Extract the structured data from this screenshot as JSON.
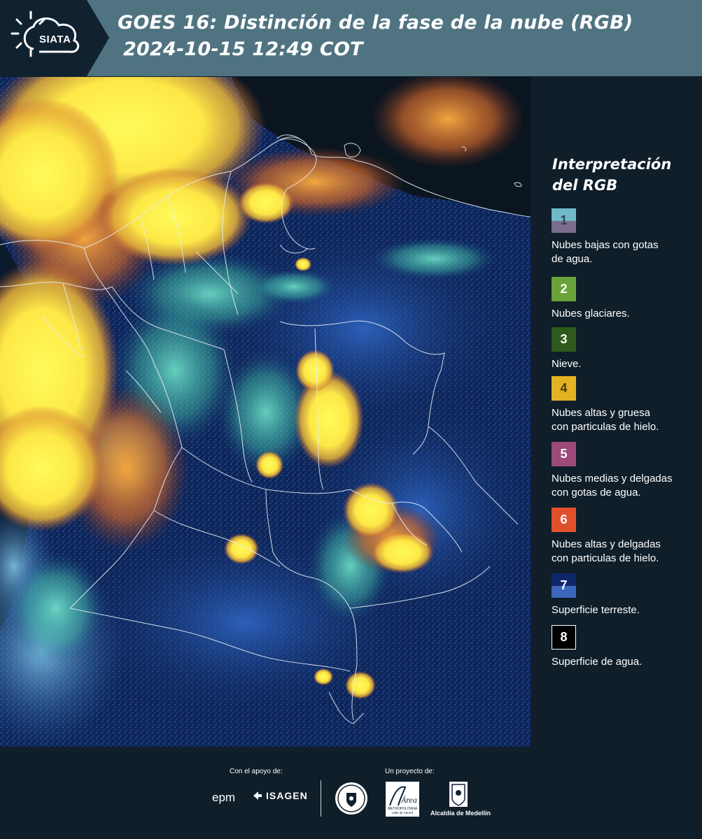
{
  "header": {
    "logo_text": "SIATA",
    "title_line1": "GOES 16: Distinción de la fase de la nube (RGB)",
    "title_line2": "2024-10-15 12:49 COT"
  },
  "map": {
    "icon": "satellite-rgb-map-colombia",
    "background_color": "#0d2150"
  },
  "legend": {
    "title_line1": "Interpretación",
    "title_line2": "del RGB",
    "items": [
      {
        "number": "1",
        "label_line1": "Nubes bajas con gotas",
        "label_line2": "de agua.",
        "color_top": "#6fb9c8",
        "color_bottom": "#7b6d8c"
      },
      {
        "number": "2",
        "label_line1": "Nubes glaciares.",
        "label_line2": "",
        "color": "#6aa339"
      },
      {
        "number": "3",
        "label_line1": "Nieve.",
        "label_line2": "",
        "color": "#2e5a1d"
      },
      {
        "number": "4",
        "label_line1": "Nubes altas y gruesa",
        "label_line2": "con particulas de hielo.",
        "color": "#e4b321"
      },
      {
        "number": "5",
        "label_line1": "Nubes medias y delgadas",
        "label_line2": "con gotas de agua.",
        "color": "#9c4a7a"
      },
      {
        "number": "6",
        "label_line1": "Nubes altas y delgadas",
        "label_line2": "con particulas de hielo.",
        "color": "#e1502c"
      },
      {
        "number": "7",
        "label_line1": "Superficie terreste.",
        "label_line2": "",
        "color_top": "#10266a",
        "color_bottom": "#3d67bd"
      },
      {
        "number": "8",
        "label_line1": "Superficie de agua.",
        "label_line2": "",
        "color": "#000000"
      }
    ]
  },
  "footer": {
    "support_label": "Con el apoyo de:",
    "project_label": "Un proyecto de:",
    "epm_text": "epm",
    "isagen_text": "ISAGEN",
    "area_text": "Área",
    "area_sub": "METROPOLITANA",
    "area_sub2": "Valle de Aburrá",
    "alcaldia_text": "Alcaldía de Medellín"
  }
}
